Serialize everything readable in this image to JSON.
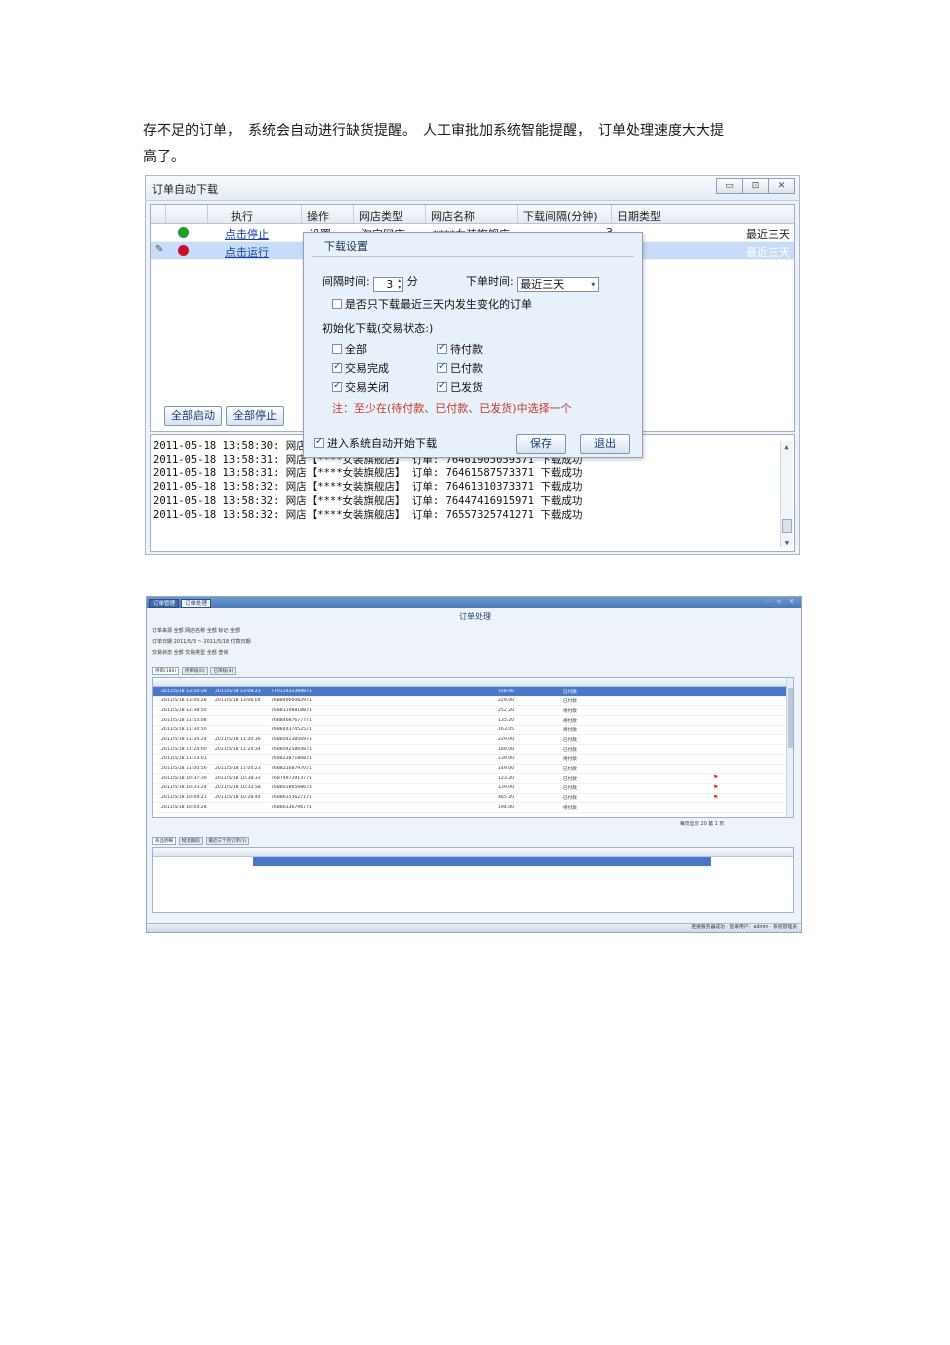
{
  "paragraph": {
    "line1": "存不足的订单，　系统会自动进行缺货提醒。　人工审批加系统智能提醒，　订单处理速度大大提",
    "line2": "高了。"
  },
  "download_window": {
    "title": "订单自动下载",
    "window_buttons": [
      "▭",
      "⊡",
      "✕"
    ],
    "columns": [
      "执行",
      "操作",
      "网店类型",
      "网店名称",
      "下载间隔(分钟)",
      "日期类型"
    ],
    "rows": [
      {
        "status_color": "#1f9e2f",
        "exec": "点击停止",
        "op": "设置",
        "shop_type": "淘宝网店",
        "shop_name": "****女装旗舰店",
        "interval": "3",
        "date_type": "最近三天"
      },
      {
        "status_color": "#c8102e",
        "exec": "点击运行",
        "op": "",
        "shop_type": "",
        "shop_name": "",
        "interval": "",
        "date_type": "最近三天"
      }
    ],
    "buttons": {
      "start_all": "全部启动",
      "stop_all": "全部停止"
    },
    "log_lines": [
      "2011-05-18 13:58:30: 网店【****女装旗舰店】 订单: 76585321119171  下载成功",
      "2011-05-18 13:58:31: 网店【****女装旗舰店】 订单: 76461905059371  下载成功",
      "2011-05-18 13:58:31: 网店【****女装旗舰店】 订单: 76461587573371  下载成功",
      "2011-05-18 13:58:32: 网店【****女装旗舰店】 订单: 76461310373371  下载成功",
      "2011-05-18 13:58:32: 网店【****女装旗舰店】 订单: 76447416915971  下载成功",
      "2011-05-18 13:58:32: 网店【****女装旗舰店】 订单: 76557325741271  下载成功"
    ]
  },
  "settings_dialog": {
    "title": "下载设置",
    "interval_label": "间隔时间:",
    "interval_value": "3",
    "interval_unit": "分",
    "order_time_label": "下单时间:",
    "order_time_value": "最近三天",
    "only_changed_label": "是否只下载最近三天内发生变化的订单",
    "init_label": "初始化下载(交易状态:)",
    "checks": {
      "all": "全部",
      "pending_pay": "待付款",
      "done": "交易完成",
      "paid": "已付款",
      "closed": "交易关闭",
      "shipped": "已发货"
    },
    "note": "注：至少在(待付款、已付款、已发货)中选择一个",
    "auto_start_label": "进入系统自动开始下载",
    "save": "保存",
    "exit": "退出"
  },
  "order_window": {
    "tabs": [
      "订单管理",
      "订单处理"
    ],
    "page_title": "订单处理",
    "filter_rows": [
      "订单来源  全部   网店名称  全部   标记  全部",
      "订单日期  2011/5/3  ~  2011/5/18  付款日期",
      "交易状态  全部   交易类型  全部   查询"
    ],
    "sub_tabs": [
      "待审(180)",
      "待审核(0)",
      "已审核(4)"
    ],
    "rows": [
      {
        "date": "2011/5/18 13:10:28",
        "pay": "2011/5/18 13:08:23",
        "no": "77011431389871",
        "amt": "158.00",
        "status": "已付款",
        "sel": true
      },
      {
        "date": "2011/5/18 13:00:28",
        "pay": "2011/5/18 13:06:04",
        "no": "76884966082971",
        "amt": "229.00",
        "status": "已付款"
      },
      {
        "date": "2011/5/18 12:38:50",
        "pay": "",
        "no": "76881198818871",
        "amt": "252.20",
        "status": "待付款"
      },
      {
        "date": "2011/5/18 11:55:08",
        "pay": "",
        "no": "76884687677771",
        "amt": "135.20",
        "status": "待付款"
      },
      {
        "date": "2011/5/18 11:34:50",
        "pay": "",
        "no": "76884437452571",
        "amt": "163.05",
        "status": "待付款"
      },
      {
        "date": "2011/5/18 11:34:24",
        "pay": "2011/5/18 11:30:36",
        "no": "76880413856971",
        "amt": "229.00",
        "status": "已付款"
      },
      {
        "date": "2011/5/18 11:24:00",
        "pay": "2011/5/18 11:24:34",
        "no": "76880425864871",
        "amt": "189.00",
        "status": "已付款"
      },
      {
        "date": "2011/5/18 11:13:01",
        "pay": "",
        "no": "76882387186871",
        "amt": "139.00",
        "status": "待付款"
      },
      {
        "date": "2011/5/18 11:00:56",
        "pay": "2011/5/18 11:04:23",
        "no": "76882168797071",
        "amt": "149.00",
        "status": "已付款"
      },
      {
        "date": "2011/5/18 10:37:39",
        "pay": "2011/5/18 10:38:33",
        "no": "76874972913771",
        "amt": "123.20",
        "status": "已付款",
        "flag": true
      },
      {
        "date": "2011/5/18 10:33:24",
        "pay": "2011/5/18 10:33:58",
        "no": "76880186598671",
        "amt": "139.00",
        "status": "已付款",
        "flag": true
      },
      {
        "date": "2011/5/18 10:09:21",
        "pay": "2011/5/18 10:28:44",
        "no": "76886153627171",
        "amt": "465.20",
        "status": "已付款",
        "flag": true
      },
      {
        "date": "2011/5/18 10:04:28",
        "pay": "",
        "no": "76886336796771",
        "amt": "194.00",
        "status": "待付款"
      }
    ],
    "pager": "每页显示  20  第 1 页",
    "lower_tabs": [
      "商品明细",
      "物流跟踪",
      "最近三个月订单(1)"
    ],
    "status_bar": "连接服务器成功 · 登录用户：admin · 系统管理员"
  }
}
